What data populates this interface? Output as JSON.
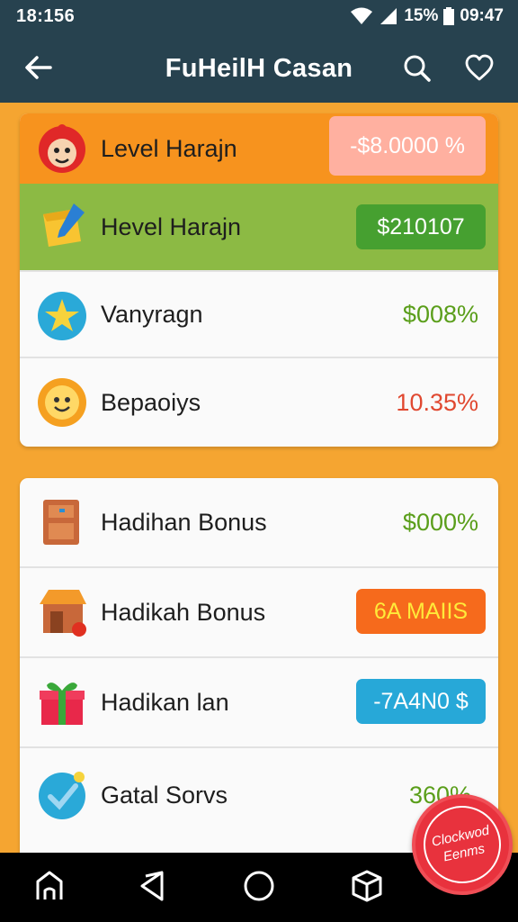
{
  "status_bar": {
    "time": "18:156",
    "battery": "15%",
    "clock": "09:47"
  },
  "app_bar": {
    "title": "FuHeilH Casan",
    "icons": [
      "back-arrow-icon",
      "search-icon",
      "heart-icon"
    ]
  },
  "card_top": {
    "rows": [
      {
        "label": "Level Harajn",
        "value": "-$8.0000 %",
        "icon": "monkey-icon",
        "row_color": "#f7931e",
        "value_style": "pill",
        "pill_color": "#ffb0a0",
        "pill_text_color": "#ffffff"
      },
      {
        "label": "Hevel Harajn",
        "value": "$210107",
        "icon": "box-pencil-icon",
        "row_color": "#8cba44",
        "value_style": "pill",
        "pill_color": "#46a030",
        "pill_text_color": "#ffffff"
      },
      {
        "label": "Vanyragn",
        "value": "$008%",
        "icon": "star-badge-icon",
        "value_style": "text",
        "value_color": "#5a9e1a"
      },
      {
        "label": "Bepaoiys",
        "value": "10.35%",
        "icon": "smiley-coin-icon",
        "value_style": "text",
        "value_color": "#e04830"
      }
    ]
  },
  "card_bottom": {
    "rows": [
      {
        "label": "Hadihan Bonus",
        "value": "$000%",
        "icon": "cabinet-icon",
        "value_style": "text",
        "value_color": "#5a9e1a"
      },
      {
        "label": "Hadikah Bonus",
        "value": "6A MAIIS",
        "icon": "market-stall-icon",
        "value_style": "pill",
        "pill_color": "#f66a1c",
        "pill_text_color": "#ffea3a"
      },
      {
        "label": "Hadikan lan",
        "value": "-7A4N0 $",
        "icon": "gift-box-icon",
        "value_style": "pill",
        "pill_color": "#27a8d8",
        "pill_text_color": "#ffffff"
      },
      {
        "label": "Gatal Sorvs",
        "value": "360%",
        "icon": "check-badge-icon",
        "value_style": "text",
        "value_color": "#5a9e1a"
      }
    ]
  },
  "fab": {
    "line1": "Clockwod",
    "line2": "Eenms",
    "color": "#e8323d"
  },
  "nav_bar": {
    "icons": [
      "home-icon",
      "back-triangle-icon",
      "home-circle-icon",
      "cube-icon",
      "recent-icon"
    ]
  }
}
